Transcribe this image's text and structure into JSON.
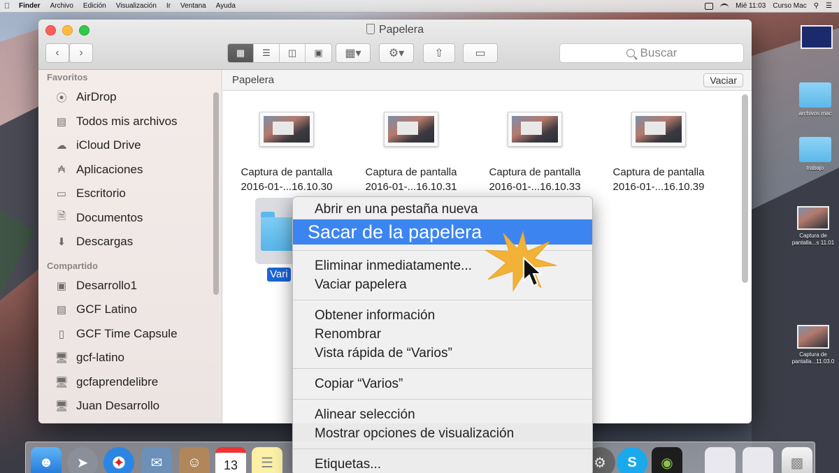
{
  "menubar": {
    "items": [
      "Finder",
      "Archivo",
      "Edición",
      "Visualización",
      "Ir",
      "Ventana",
      "Ayuda"
    ],
    "clock": "Mié 11:03",
    "user": "Curso Mac"
  },
  "window": {
    "title": "Papelera",
    "search_placeholder": "Buscar",
    "path": "Papelera",
    "empty_button": "Vaciar"
  },
  "sidebar": {
    "favorites_header": "Favoritos",
    "favorites": [
      {
        "label": "AirDrop",
        "icon": "airdrop-icon"
      },
      {
        "label": "Todos mis archivos",
        "icon": "all-files-icon"
      },
      {
        "label": "iCloud Drive",
        "icon": "cloud-icon"
      },
      {
        "label": "Aplicaciones",
        "icon": "applications-icon"
      },
      {
        "label": "Escritorio",
        "icon": "desktop-icon"
      },
      {
        "label": "Documentos",
        "icon": "documents-icon"
      },
      {
        "label": "Descargas",
        "icon": "downloads-icon"
      }
    ],
    "shared_header": "Compartido",
    "shared": [
      {
        "label": "Desarrollo1",
        "icon": "server-icon"
      },
      {
        "label": "GCF Latino",
        "icon": "network-drive-icon"
      },
      {
        "label": "GCF Time Capsule",
        "icon": "time-capsule-icon"
      },
      {
        "label": "gcf-latino",
        "icon": "monitor-icon"
      },
      {
        "label": "gcfaprendelibre",
        "icon": "monitor-icon"
      },
      {
        "label": "Juan Desarrollo",
        "icon": "monitor-icon"
      }
    ]
  },
  "files": [
    {
      "line1": "Captura de pantalla",
      "line2": "2016-01-...16.10.30"
    },
    {
      "line1": "Captura de pantalla",
      "line2": "2016-01-...16.10.31"
    },
    {
      "line1": "Captura de pantalla",
      "line2": "2016-01-...16.10.33"
    },
    {
      "line1": "Captura de pantalla",
      "line2": "2016-01-...16.10.39"
    }
  ],
  "folder": {
    "label": "Vari"
  },
  "context_menu": {
    "items": [
      "Abrir en una pestaña nueva",
      "Sacar de la papelera",
      "Eliminar inmediatamente...",
      "Vaciar papelera",
      "Obtener información",
      "Renombrar",
      "Vista rápida de “Varios”",
      "Copiar “Varios”",
      "Alinear selección",
      "Mostrar opciones de visualización",
      "Etiquetas..."
    ],
    "highlighted_index": 1
  },
  "desktop": {
    "items": [
      "",
      "archivos mac",
      "trabajo",
      "Captura de pantalla...s 11.01",
      "Captura de pantalla...11.03.0"
    ]
  },
  "dock": {
    "calendar_day": "13"
  },
  "colors": {
    "highlight": "#3c85f1",
    "selection": "#1c64d8",
    "folder": "#5db8ec"
  }
}
